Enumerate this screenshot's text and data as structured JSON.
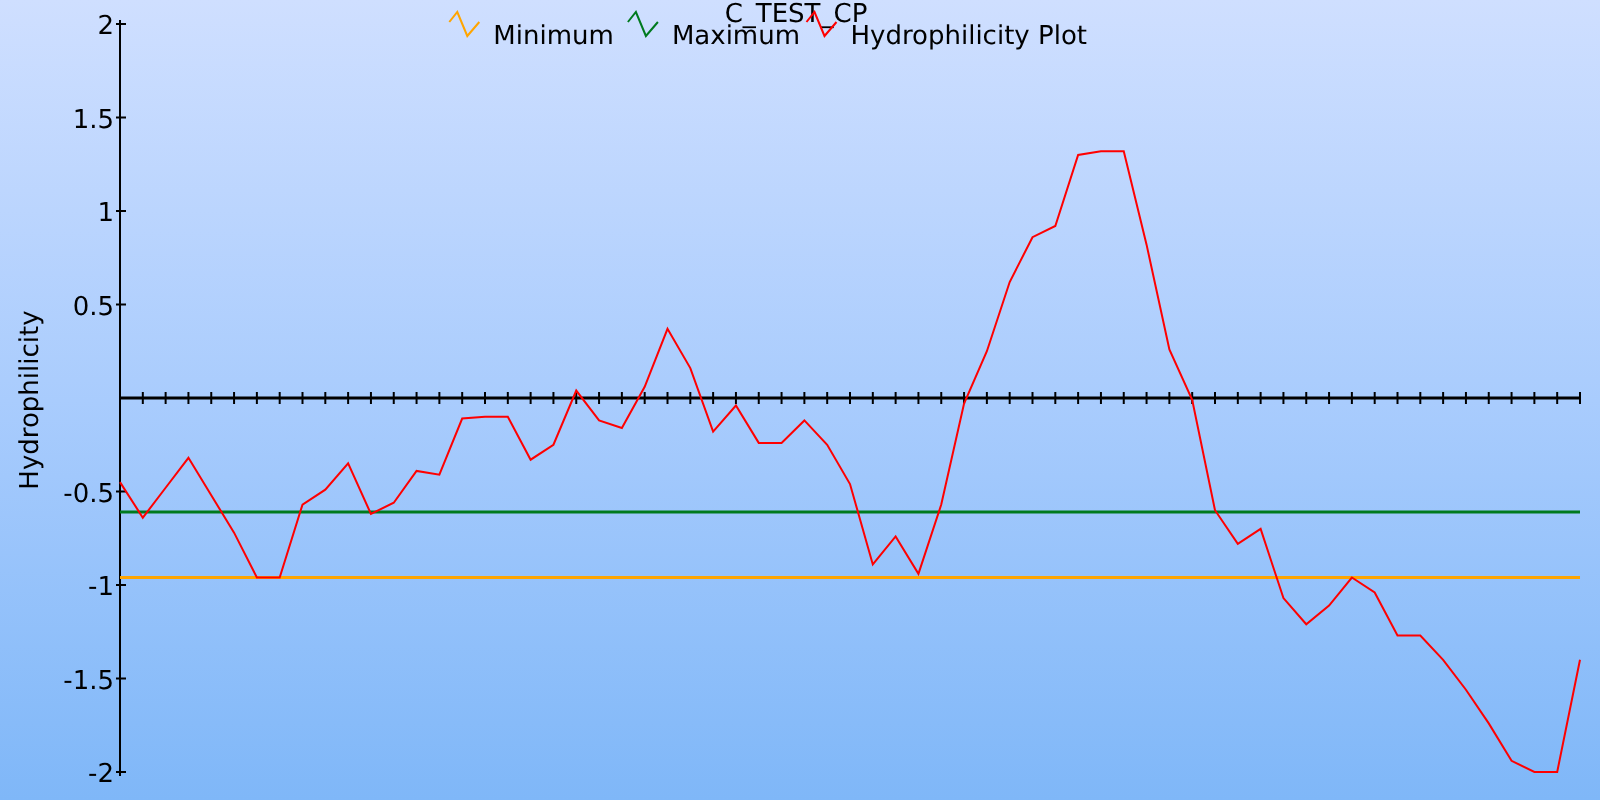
{
  "chart_data": {
    "type": "line",
    "title": "C_TEST_CP",
    "ylabel": "Hydrophilicity",
    "legend": "top",
    "ylim": [
      -2,
      2
    ],
    "yticks": [
      -2,
      -1.5,
      -1,
      -0.5,
      0.5,
      1,
      1.5,
      2
    ],
    "series": [
      {
        "name": "Minimum",
        "color": "#ffa500",
        "values": [
          -0.96,
          -0.96,
          -0.96,
          -0.96,
          -0.96,
          -0.96,
          -0.96,
          -0.96,
          -0.96,
          -0.96,
          -0.96,
          -0.96,
          -0.96,
          -0.96,
          -0.96,
          -0.96,
          -0.96,
          -0.96,
          -0.96,
          -0.96,
          -0.96,
          -0.96,
          -0.96,
          -0.96,
          -0.96,
          -0.96,
          -0.96,
          -0.96,
          -0.96,
          -0.96,
          -0.96,
          -0.96,
          -0.96,
          -0.96,
          -0.96,
          -0.96,
          -0.96,
          -0.96,
          -0.96,
          -0.96,
          -0.96,
          -0.96,
          -0.96,
          -0.96,
          -0.96,
          -0.96,
          -0.96,
          -0.96,
          -0.96,
          -0.96,
          -0.96,
          -0.96,
          -0.96,
          -0.96,
          -0.96,
          -0.96,
          -0.96,
          -0.96,
          -0.96,
          -0.96,
          -0.96,
          -0.96,
          -0.96,
          -0.96,
          -0.96
        ]
      },
      {
        "name": "Maximum",
        "color": "#007a1e",
        "values": [
          -0.61,
          -0.61,
          -0.61,
          -0.61,
          -0.61,
          -0.61,
          -0.61,
          -0.61,
          -0.61,
          -0.61,
          -0.61,
          -0.61,
          -0.61,
          -0.61,
          -0.61,
          -0.61,
          -0.61,
          -0.61,
          -0.61,
          -0.61,
          -0.61,
          -0.61,
          -0.61,
          -0.61,
          -0.61,
          -0.61,
          -0.61,
          -0.61,
          -0.61,
          -0.61,
          -0.61,
          -0.61,
          -0.61,
          -0.61,
          -0.61,
          -0.61,
          -0.61,
          -0.61,
          -0.61,
          -0.61,
          -0.61,
          -0.61,
          -0.61,
          -0.61,
          -0.61,
          -0.61,
          -0.61,
          -0.61,
          -0.61,
          -0.61,
          -0.61,
          -0.61,
          -0.61,
          -0.61,
          -0.61,
          -0.61,
          -0.61,
          -0.61,
          -0.61,
          -0.61,
          -0.61,
          -0.61,
          -0.61,
          -0.61,
          -0.61
        ]
      },
      {
        "name": "Hydrophilicity Plot",
        "color": "#ff0000",
        "values": [
          -0.45,
          -0.64,
          -0.48,
          -0.32,
          -0.52,
          -0.72,
          -0.96,
          -0.96,
          -0.57,
          -0.49,
          -0.35,
          -0.62,
          -0.56,
          -0.39,
          -0.41,
          -0.11,
          -0.1,
          -0.1,
          -0.33,
          -0.25,
          0.04,
          -0.12,
          -0.16,
          0.06,
          0.37,
          0.16,
          -0.18,
          -0.04,
          -0.24,
          -0.24,
          -0.12,
          -0.25,
          -0.46,
          -0.89,
          -0.74,
          -0.94,
          -0.57,
          -0.03,
          0.25,
          0.62,
          0.86,
          0.92,
          1.3,
          1.32,
          1.32,
          0.82,
          0.26,
          -0.01,
          -0.6,
          -0.78,
          -0.7,
          -1.07,
          -1.21,
          -1.11,
          -0.96,
          -1.04,
          -1.27,
          -1.27,
          -1.4,
          -1.56,
          -1.74,
          -1.94,
          -2,
          -2,
          -1.4
        ]
      }
    ]
  }
}
